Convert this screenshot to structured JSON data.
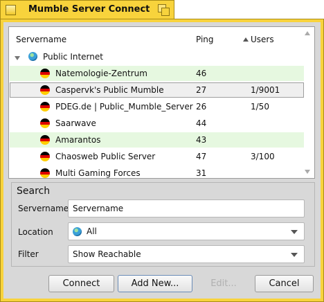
{
  "window": {
    "title": "Mumble Server Connect"
  },
  "columns": {
    "name": "Servername",
    "ping": "Ping",
    "users": "Users"
  },
  "group": {
    "label": "Public Internet"
  },
  "servers": [
    {
      "name": "Natemologie-Zentrum",
      "ping": "46",
      "users": ""
    },
    {
      "name": "Caspervk's Public Mumble",
      "ping": "27",
      "users": "1/9001"
    },
    {
      "name": "PDEG.de | Public_Mumble_Server",
      "ping": "26",
      "users": "1/50"
    },
    {
      "name": "Saarwave",
      "ping": "44",
      "users": ""
    },
    {
      "name": "Amarantos",
      "ping": "43",
      "users": ""
    },
    {
      "name": "Chaosweb Public Server",
      "ping": "47",
      "users": "3/100"
    },
    {
      "name": "Multi Gaming Forces",
      "ping": "31",
      "users": ""
    }
  ],
  "search": {
    "heading": "Search",
    "servername_label": "Servername",
    "servername_value": "Servername",
    "location_label": "Location",
    "location_value": "All",
    "filter_label": "Filter",
    "filter_value": "Show Reachable"
  },
  "buttons": {
    "connect": "Connect",
    "add_new": "Add New...",
    "edit": "Edit...",
    "cancel": "Cancel"
  },
  "colors": {
    "title_tab": "#f8d33c",
    "row_highlight": "#e6f8e0",
    "flag_de": [
      "#000000",
      "#dd0000",
      "#ffce00"
    ]
  }
}
